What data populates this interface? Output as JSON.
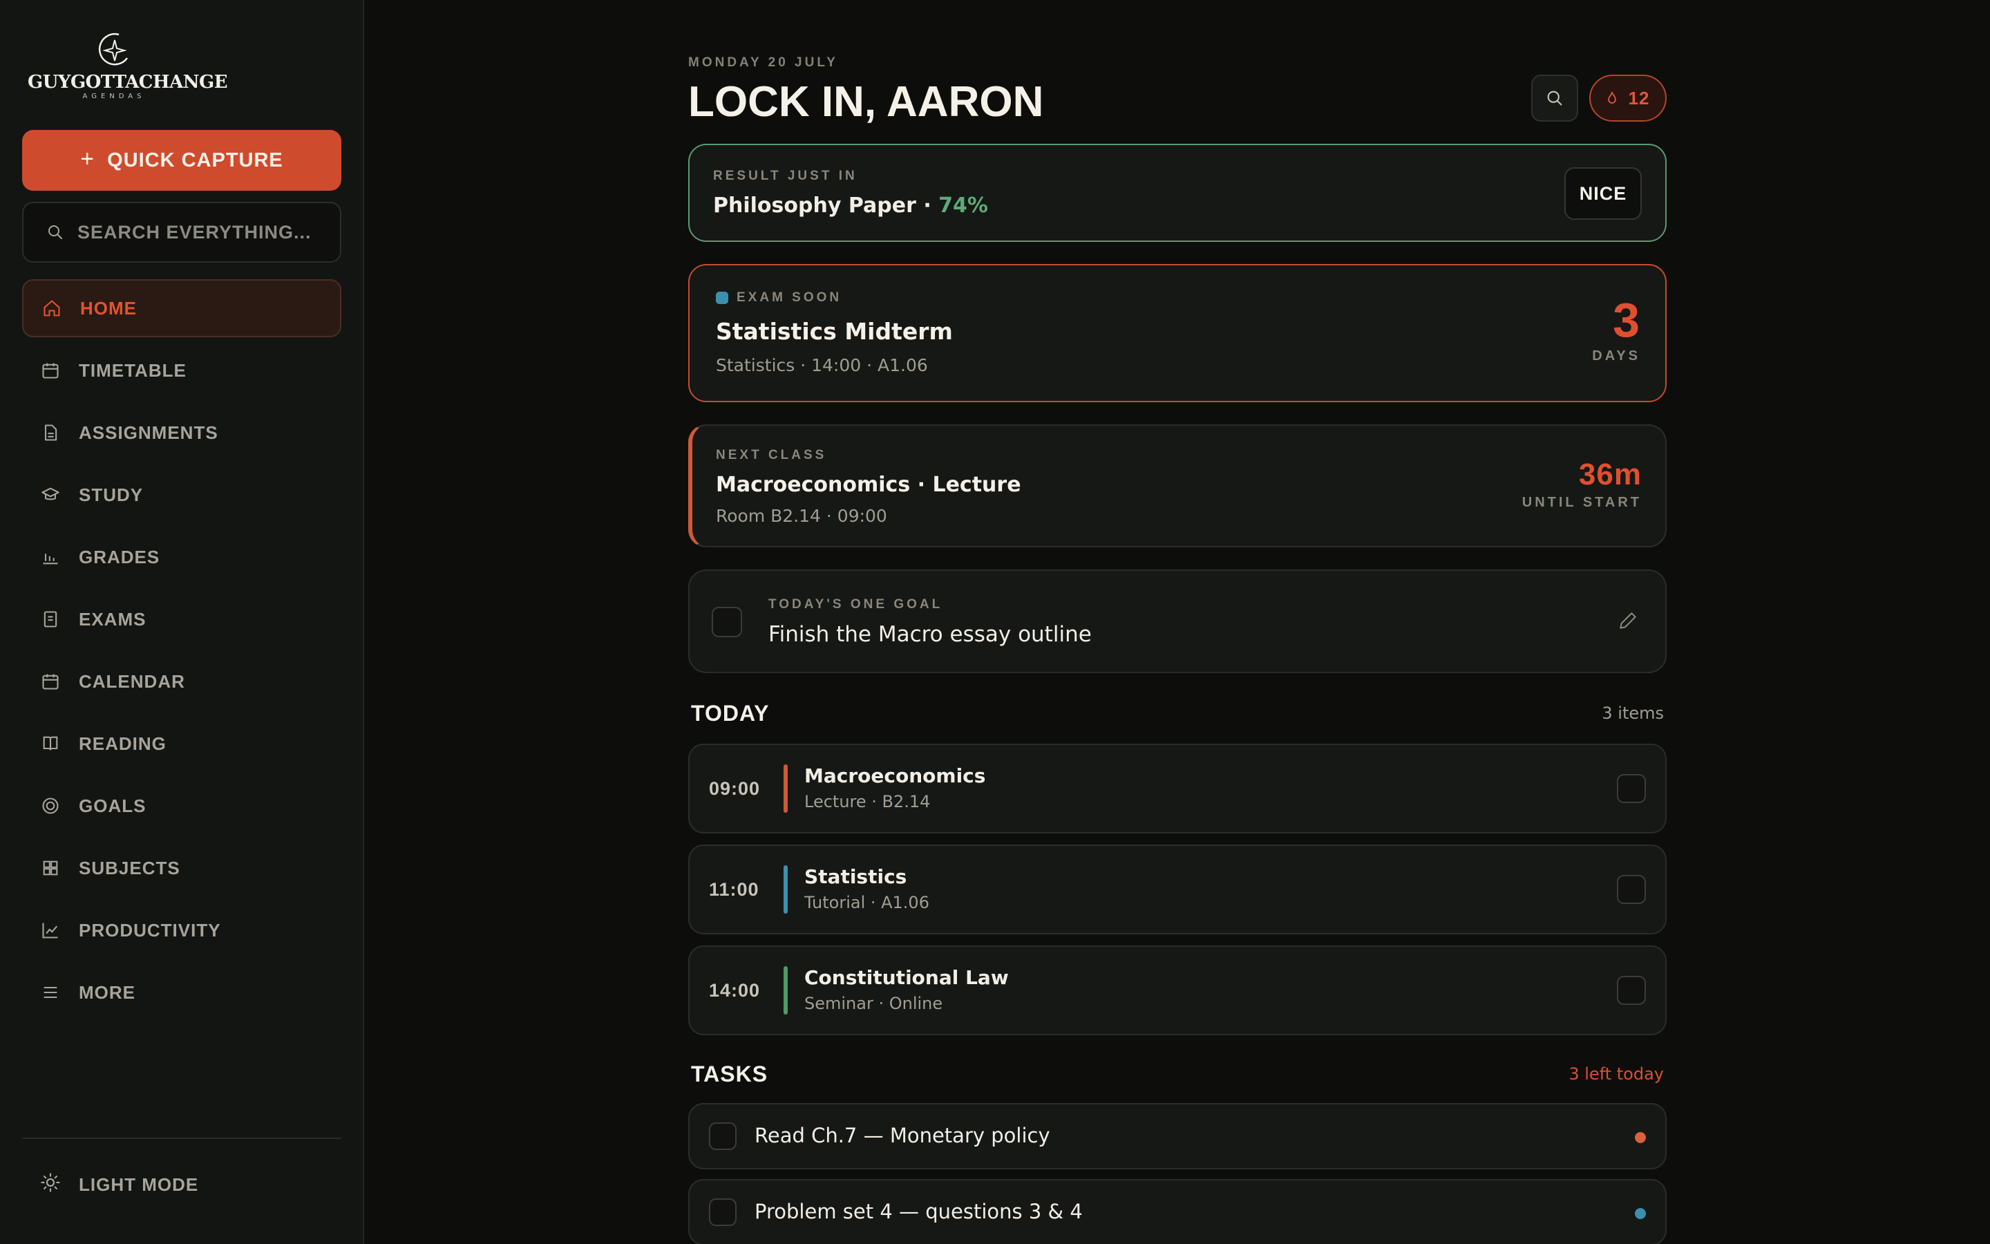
{
  "brand": {
    "name": "GUYGOTTACHANGE",
    "sub": "AGENDAS"
  },
  "sidebar": {
    "quick_capture": "QUICK CAPTURE",
    "search_placeholder": "SEARCH EVERYTHING...",
    "items": [
      {
        "label": "HOME",
        "icon": "home-icon"
      },
      {
        "label": "TIMETABLE",
        "icon": "calendar-icon"
      },
      {
        "label": "ASSIGNMENTS",
        "icon": "document-icon"
      },
      {
        "label": "STUDY",
        "icon": "graduation-cap-icon"
      },
      {
        "label": "GRADES",
        "icon": "bar-chart-icon"
      },
      {
        "label": "EXAMS",
        "icon": "clipboard-icon"
      },
      {
        "label": "CALENDAR",
        "icon": "calendar-icon"
      },
      {
        "label": "READING",
        "icon": "book-icon"
      },
      {
        "label": "GOALS",
        "icon": "target-icon"
      },
      {
        "label": "SUBJECTS",
        "icon": "grid-icon"
      },
      {
        "label": "PRODUCTIVITY",
        "icon": "line-chart-icon"
      },
      {
        "label": "MORE",
        "icon": "menu-icon"
      }
    ],
    "light_mode": "LIGHT MODE"
  },
  "header": {
    "date": "MONDAY 20 JULY",
    "greeting": "LOCK IN, AARON",
    "streak": "12"
  },
  "result": {
    "label": "RESULT JUST IN",
    "title": "Philosophy Paper",
    "separator": " · ",
    "score": "74%",
    "button": "NICE"
  },
  "exam": {
    "label": "EXAM SOON",
    "title": "Statistics Midterm",
    "meta": "Statistics · 14:00 · A1.06",
    "countdown": "3",
    "unit": "DAYS"
  },
  "next_class": {
    "label": "NEXT CLASS",
    "title": "Macroeconomics · Lecture",
    "meta": "Room B2.14 · 09:00",
    "countdown": "36m",
    "unit": "UNTIL START"
  },
  "goal": {
    "label": "TODAY'S ONE GOAL",
    "title": "Finish the Macro essay outline"
  },
  "today": {
    "title": "TODAY",
    "count": "3 items",
    "items": [
      {
        "time": "09:00",
        "title": "Macroeconomics",
        "meta": "Lecture · B2.14",
        "color": "#cf5a37"
      },
      {
        "time": "11:00",
        "title": "Statistics",
        "meta": "Tutorial · A1.06",
        "color": "#3b90b0"
      },
      {
        "time": "14:00",
        "title": "Constitutional Law",
        "meta": "Seminar · Online",
        "color": "#4f9a68"
      }
    ]
  },
  "tasks": {
    "title": "TASKS",
    "count": "3 left today",
    "items": [
      {
        "title": "Read Ch.7 — Monetary policy",
        "color": "#d9613e"
      },
      {
        "title": "Problem set 4 — questions 3 & 4",
        "color": "#3b90b0"
      }
    ]
  },
  "colors": {
    "accent": "#cf4b2d",
    "success": "#5daa76",
    "info": "#3b90b0"
  }
}
